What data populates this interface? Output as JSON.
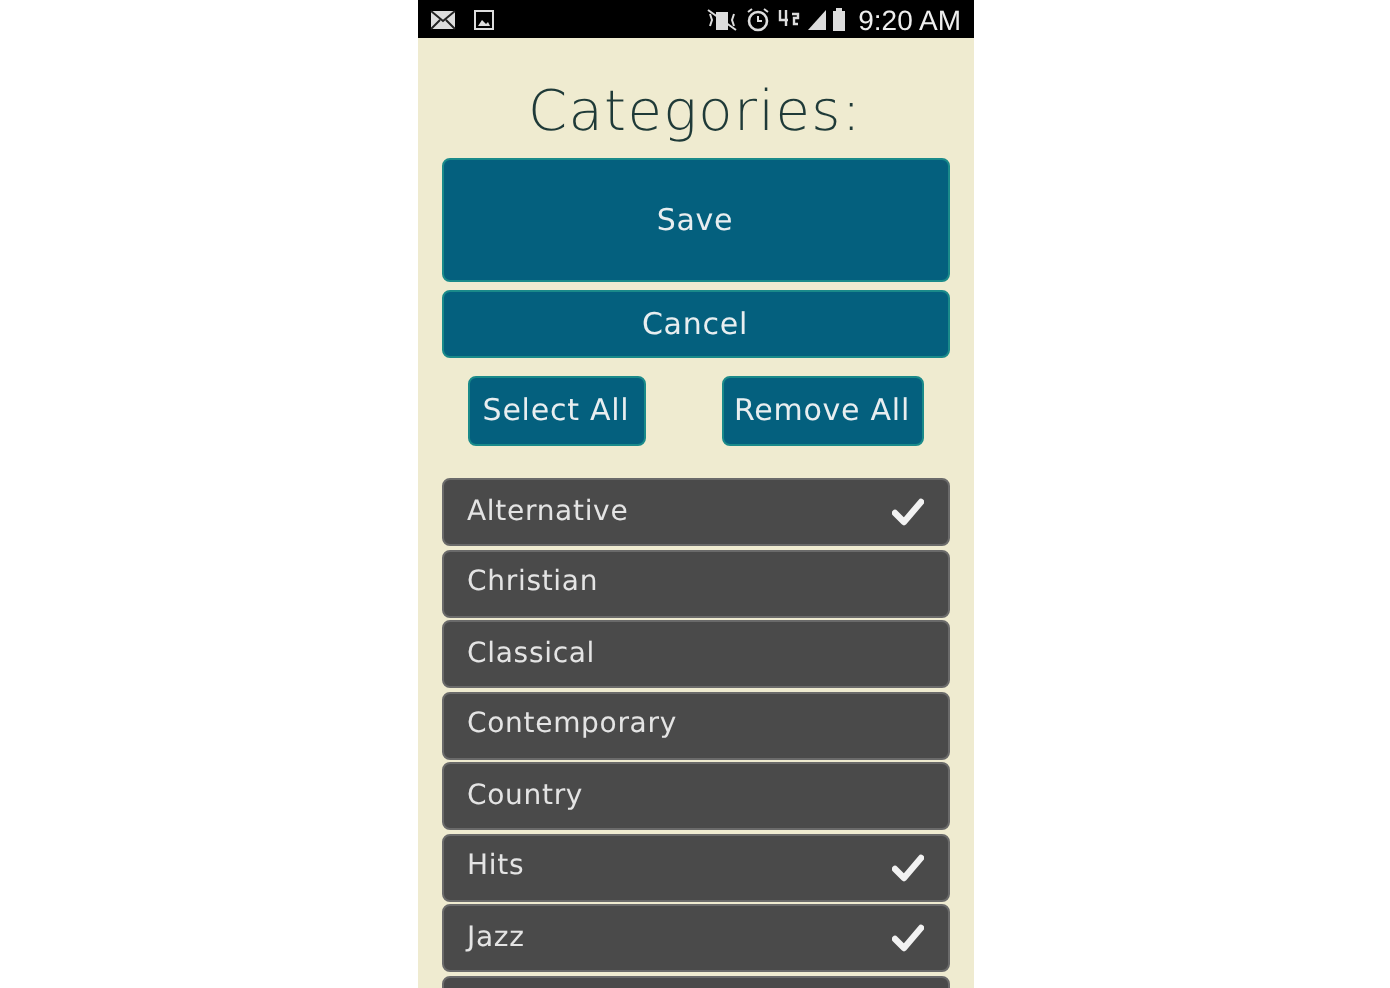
{
  "status_bar": {
    "time": "9:20 AM"
  },
  "title": "Categories:",
  "buttons": {
    "save": "Save",
    "cancel": "Cancel",
    "select_all": "Select All",
    "remove_all": "Remove All"
  },
  "categories": [
    {
      "label": "Alternative",
      "checked": true
    },
    {
      "label": "Christian",
      "checked": false
    },
    {
      "label": "Classical",
      "checked": false
    },
    {
      "label": "Contemporary",
      "checked": false
    },
    {
      "label": "Country",
      "checked": false
    },
    {
      "label": "Hits",
      "checked": true
    },
    {
      "label": "Jazz",
      "checked": true
    }
  ]
}
